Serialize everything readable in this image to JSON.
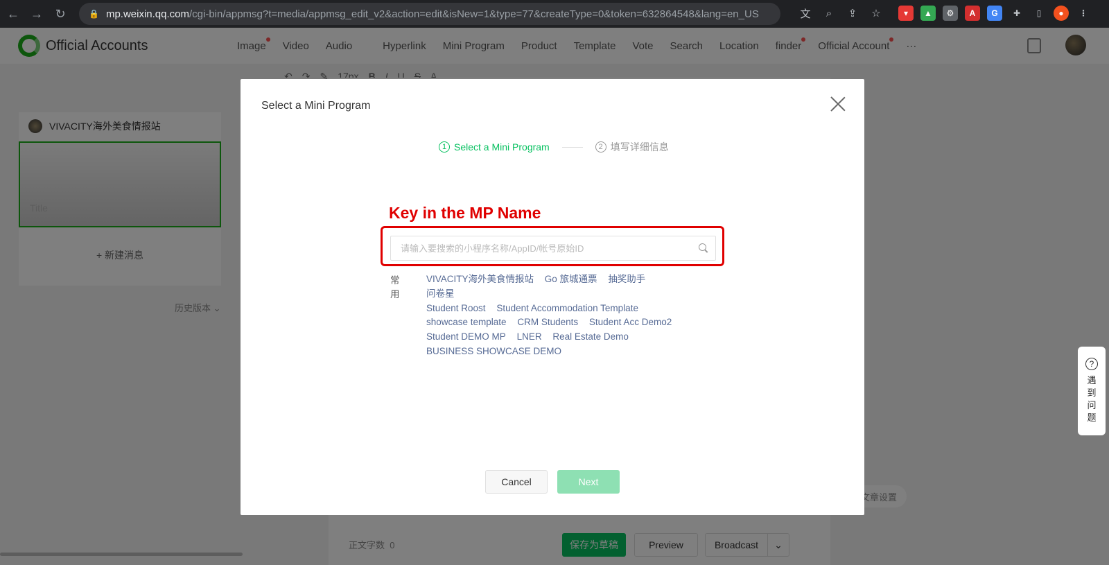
{
  "browser": {
    "lock": "🔒",
    "url_host": "mp.weixin.qq.com",
    "url_path": "/cgi-bin/appmsg?t=media/appmsg_edit_v2&action=edit&isNew=1&type=77&createType=0&token=632864548&lang=en_US"
  },
  "header": {
    "brand": "Official Accounts",
    "tabs": [
      {
        "label": "Image",
        "dot": true
      },
      {
        "label": "Video",
        "dot": false
      },
      {
        "label": "Audio",
        "dot": false
      },
      {
        "label": "Hyperlink",
        "dot": false
      },
      {
        "label": "Mini Program",
        "dot": false
      },
      {
        "label": "Product",
        "dot": false
      },
      {
        "label": "Template",
        "dot": false
      },
      {
        "label": "Vote",
        "dot": false
      },
      {
        "label": "Search",
        "dot": false
      },
      {
        "label": "Location",
        "dot": false
      },
      {
        "label": "finder",
        "dot": true
      },
      {
        "label": "Official Account",
        "dot": true
      },
      {
        "label": "···",
        "dot": false
      }
    ]
  },
  "format_bar": {
    "font_size": "17px"
  },
  "left_panel": {
    "account_name": "VIVACITY海外美食情报站",
    "cover_title_placeholder": "Title",
    "new_message": "+ 新建消息",
    "history": "历史版本 ⌄"
  },
  "footer": {
    "word_count_label": "正文字数",
    "word_count": "0",
    "save_draft": "保存为草稿",
    "preview": "Preview",
    "broadcast": "Broadcast",
    "article_settings": "文章设置"
  },
  "help": {
    "icon": "?",
    "chars": [
      "遇",
      "到",
      "问",
      "题"
    ]
  },
  "modal": {
    "title": "Select a Mini Program",
    "steps": [
      {
        "num": "1",
        "label": "Select a Mini Program"
      },
      {
        "num": "2",
        "label": "填写详细信息"
      }
    ],
    "annotation": "Key in the MP Name",
    "search_placeholder": "请输入要搜索的小程序名称/AppID/帐号原始ID",
    "search_value": "",
    "recent_label": "常用",
    "recent_items": [
      "VIVACITY海外美食情报站",
      "Go 旅城通票",
      "抽奖助手",
      "问卷星",
      "Student Roost",
      "Student Accommodation Template",
      "showcase template",
      "CRM Students",
      "Student Acc Demo2",
      "Student DEMO MP",
      "LNER",
      "Real Estate Demo",
      "BUSINESS SHOWCASE DEMO"
    ],
    "cancel": "Cancel",
    "next": "Next"
  }
}
